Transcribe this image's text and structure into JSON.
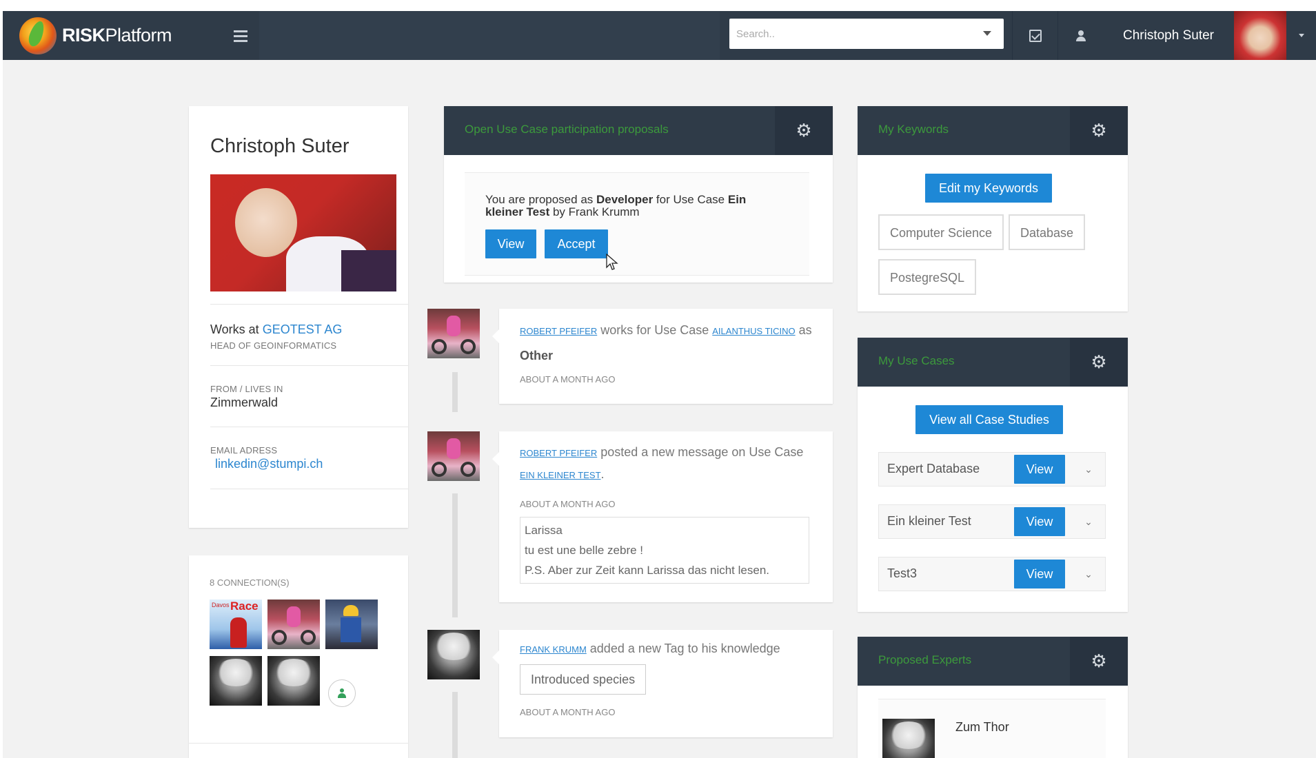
{
  "navbar": {
    "brand_bold": "RISK",
    "brand_rest": "Platform",
    "search_placeholder": "Search..",
    "username": "Christoph Suter",
    "icons": [
      "menu-icon",
      "tasks-check-icon",
      "user-icon",
      "caret-down-icon"
    ]
  },
  "profile": {
    "name": "Christoph Suter",
    "works_prefix": "Works at",
    "company": "GEOTEST AG",
    "position": "HEAD OF GEOINFORMATICS",
    "from_label": "FROM / LIVES IN",
    "from_value": "Zimmerwald",
    "email_label": "EMAIL ADRESS",
    "email": "linkedin@stumpi.ch"
  },
  "connections": {
    "title": "8 CONNECTION(S)",
    "race_small": "Davos",
    "race_big": "Race"
  },
  "proposals": {
    "title": "Open Use Case participation proposals",
    "text_1": "You are proposed as ",
    "role": "Developer",
    "text_2": " for Use Case ",
    "use_case": "Ein kleiner Test",
    "text_3": " by Frank Krumm",
    "view_label": "View",
    "accept_label": "Accept"
  },
  "timeline": [
    {
      "actor": "ROBERT PFEIFER",
      "verb": " works for Use Case ",
      "object": "AILANTHUS TICINO",
      "suffix": " as",
      "role": "Other",
      "time": "ABOUT A MONTH AGO"
    },
    {
      "actor": "ROBERT PFEIFER",
      "verb": " posted a new message on Use Case ",
      "object": "EIN KLEINER TEST",
      "suffix": ".",
      "time": "ABOUT A MONTH AGO",
      "message": [
        "Larissa",
        "tu est une belle zebre !",
        "P.S. Aber zur Zeit kann Larissa das nicht lesen."
      ]
    },
    {
      "actor": "FRANK KRUMM",
      "verb": " added a new Tag to his knowledge",
      "tag": "Introduced species",
      "time": "ABOUT A MONTH AGO"
    }
  ],
  "keywords": {
    "title": "My Keywords",
    "edit_label": "Edit my Keywords",
    "tags": [
      "Computer Science",
      "Database",
      "PostegreSQL"
    ]
  },
  "usecases": {
    "title": "My Use Cases",
    "view_all_label": "View all Case Studies",
    "items": [
      {
        "name": "Expert Database",
        "view": "View"
      },
      {
        "name": "Ein kleiner Test",
        "view": "View"
      },
      {
        "name": "Test3",
        "view": "View"
      }
    ]
  },
  "experts": {
    "title": "Proposed Experts",
    "items": [
      {
        "name": "Zum Thor"
      }
    ]
  },
  "colors": {
    "navbar": "#2f3b48",
    "accent_blue": "#1e88d6",
    "panel_title_green": "#3c9a3c",
    "link_blue": "#2c86cf",
    "background": "#f2f2f2"
  }
}
